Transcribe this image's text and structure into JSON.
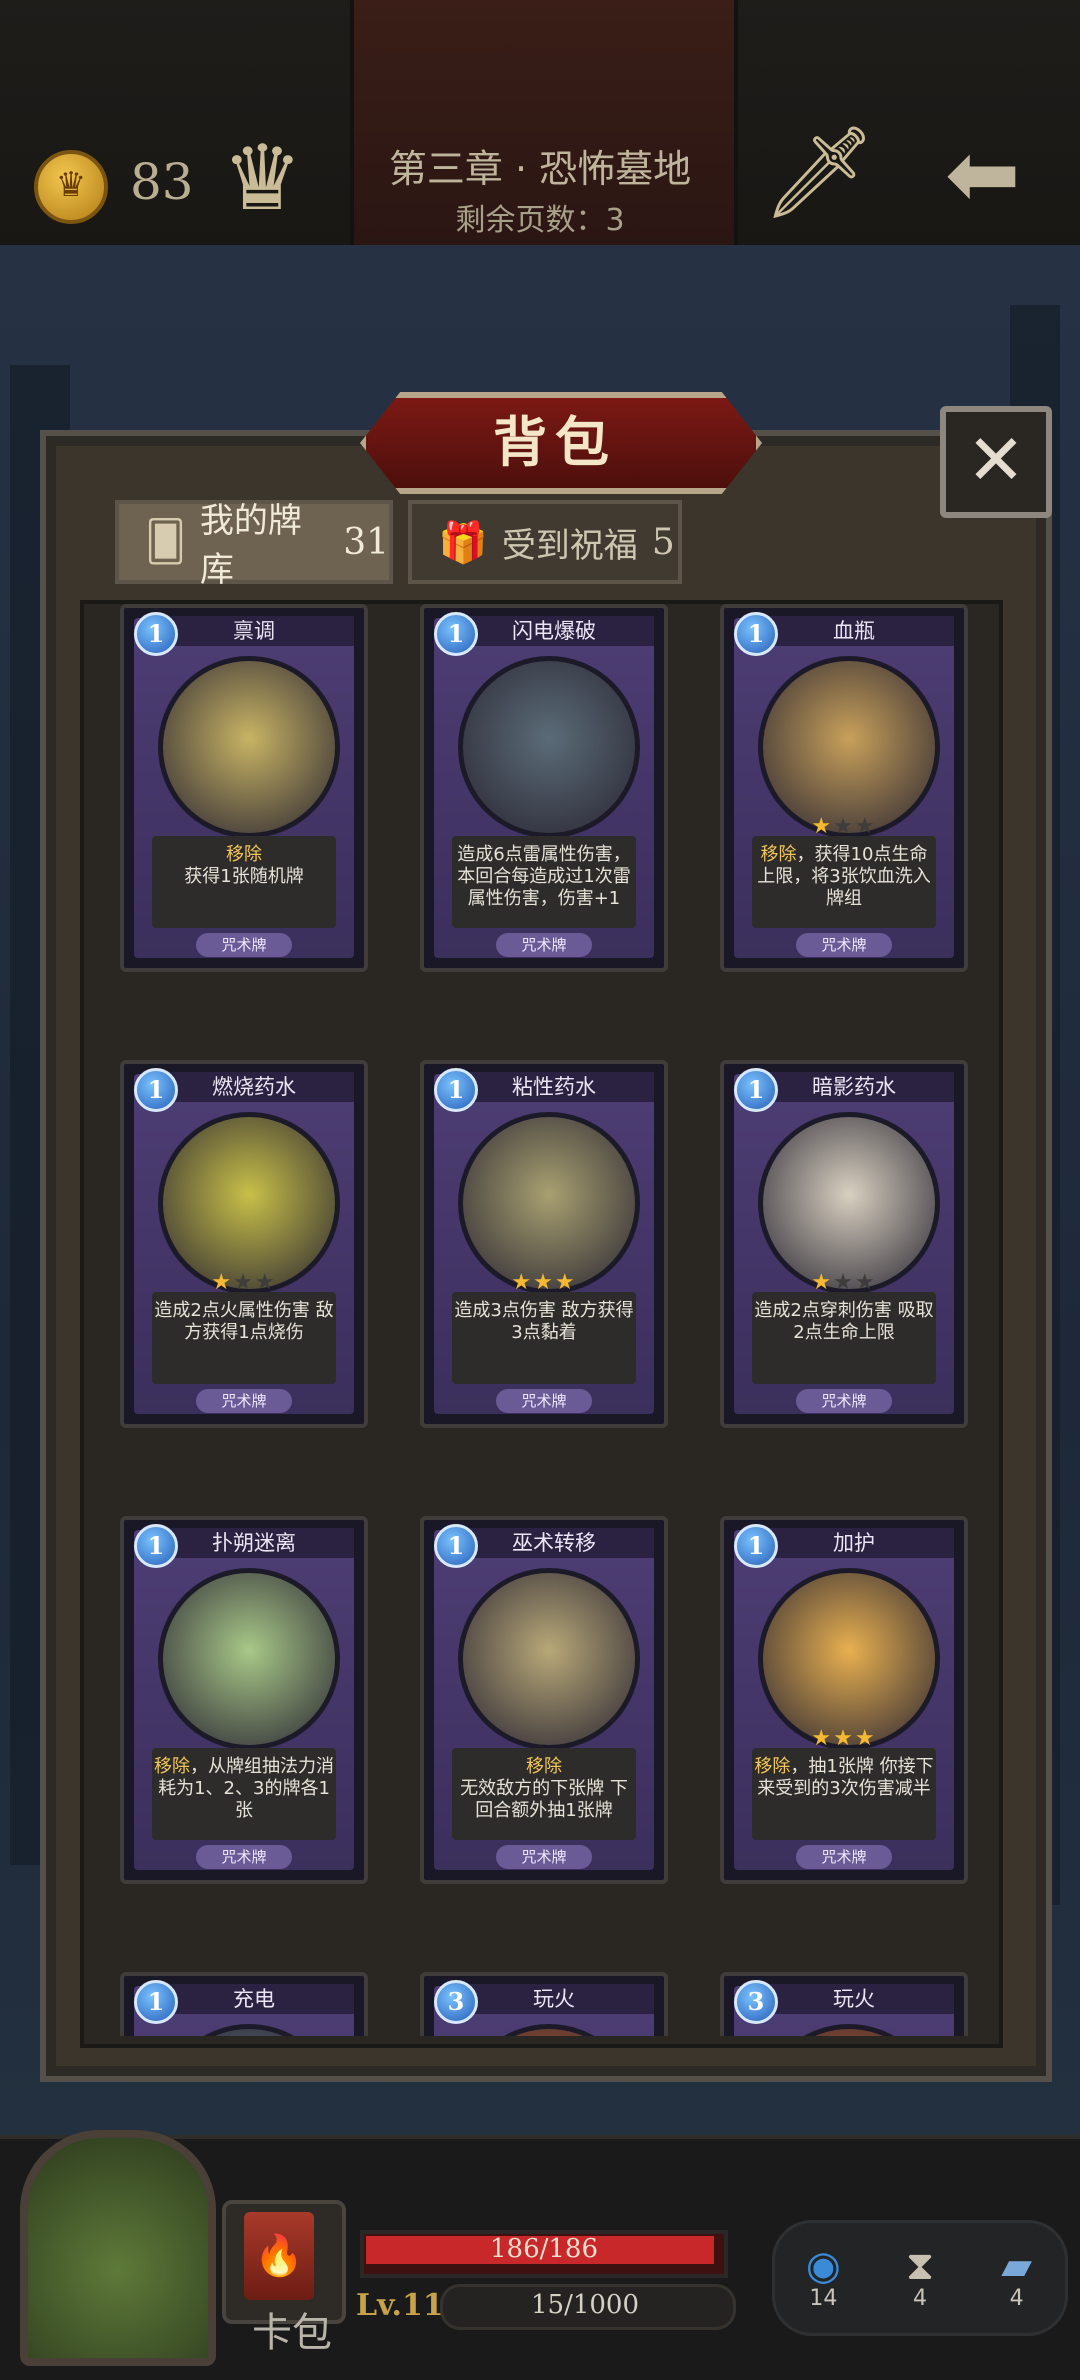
{
  "header": {
    "coin_icon_glyph": "♛",
    "coins": "83",
    "crown_icon": "crown-icon",
    "chapter_title": "第三章 · 恐怖墓地",
    "pages_remaining": "剩余页数：3",
    "sword_icon": "sword-icon",
    "back_icon": "back-arrow-icon"
  },
  "bag": {
    "title": "背包",
    "close_glyph": "✕",
    "tabs": [
      {
        "label": "我的牌库",
        "count": "31",
        "icon": "cards-icon"
      },
      {
        "label": "受到祝福",
        "count": "5",
        "icon": "gift-icon"
      }
    ]
  },
  "cards": [
    {
      "cost": "1",
      "name": "禀调",
      "stars": 0,
      "desc_kw": "移除",
      "desc": "获得1张随机牌",
      "type": "咒术牌",
      "art_color": "#c8b464"
    },
    {
      "cost": "1",
      "name": "闪电爆破",
      "stars": 0,
      "desc_kw": "",
      "desc": "造成6点雷属性伤害，本回合每造成过1次雷属性伤害，伤害+1",
      "type": "咒术牌",
      "art_color": "#5a6c78"
    },
    {
      "cost": "1",
      "name": "血瓶",
      "stars": 1,
      "desc_kw": "移除",
      "desc": "，获得10点生命上限，将3张饮血洗入牌组",
      "type": "咒术牌",
      "art_color": "#c8a05a"
    },
    {
      "cost": "1",
      "name": "燃烧药水",
      "stars": 1,
      "desc_kw": "",
      "desc": "造成2点火属性伤害 敌方获得1点烧伤",
      "type": "咒术牌",
      "art_color": "#c8c048"
    },
    {
      "cost": "1",
      "name": "粘性药水",
      "stars": 3,
      "desc_kw": "",
      "desc": "造成3点伤害 敌方获得3点黏着",
      "type": "咒术牌",
      "art_color": "#a8a070"
    },
    {
      "cost": "1",
      "name": "暗影药水",
      "stars": 1,
      "desc_kw": "",
      "desc": "造成2点穿刺伤害 吸取2点生命上限",
      "type": "咒术牌",
      "art_color": "#d8d0c0"
    },
    {
      "cost": "1",
      "name": "扑朔迷离",
      "stars": 0,
      "desc_kw": "移除",
      "desc": "，从牌组抽法力消耗为1、2、3的牌各1张",
      "type": "咒术牌",
      "art_color": "#a8c888"
    },
    {
      "cost": "1",
      "name": "巫术转移",
      "stars": 0,
      "desc_kw": "移除",
      "desc": "无效敌方的下张牌 下回合额外抽1张牌",
      "type": "咒术牌",
      "art_color": "#b8a878"
    },
    {
      "cost": "1",
      "name": "加护",
      "stars": 3,
      "desc_kw": "移除",
      "desc": "，抽1张牌 你接下来受到的3次伤害减半",
      "type": "咒术牌",
      "art_color": "#e8b050"
    },
    {
      "cost": "1",
      "name": "充电",
      "stars": 0,
      "desc_kw": "",
      "desc": "",
      "type": "",
      "art_color": "#5a6c78"
    },
    {
      "cost": "3",
      "name": "玩火",
      "stars": 0,
      "desc_kw": "",
      "desc": "",
      "type": "",
      "art_color": "#c86030"
    },
    {
      "cost": "3",
      "name": "玩火",
      "stars": 0,
      "desc_kw": "",
      "desc": "",
      "type": "",
      "art_color": "#c86030"
    }
  ],
  "footer": {
    "deck_label": "卡包",
    "hp": "186/186",
    "hp_fraction": 1.0,
    "level": "Lv.11",
    "xp": "15/1000",
    "xp_fraction": 0.015,
    "stats": [
      {
        "icon": "orb-icon",
        "glyph": "◉",
        "value": "14",
        "color": "#3a8ad8"
      },
      {
        "icon": "hourglass-icon",
        "glyph": "⧗",
        "value": "4",
        "color": "#c8c0b0"
      },
      {
        "icon": "card-stack-icon",
        "glyph": "▰",
        "value": "4",
        "color": "#7aa8d8"
      }
    ]
  }
}
